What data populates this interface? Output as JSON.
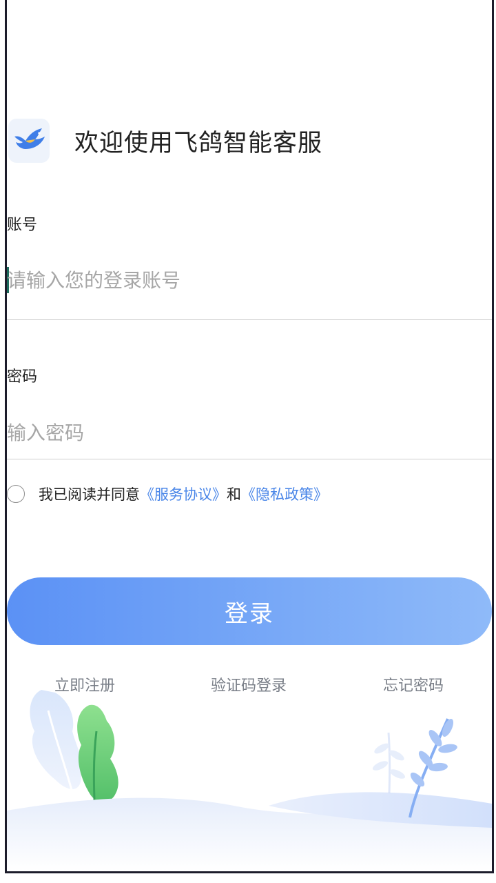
{
  "header": {
    "logo_icon": "pigeon-bird-icon",
    "title": "欢迎使用飞鸽智能客服"
  },
  "account": {
    "label": "账号",
    "placeholder": "请输入您的登录账号",
    "value": ""
  },
  "password": {
    "label": "密码",
    "placeholder": "输入密码",
    "value": ""
  },
  "agreement": {
    "prefix": "我已阅读并同意",
    "service_link": "《服务协议》",
    "conjunction": "和",
    "privacy_link": "《隐私政策》",
    "checked": false
  },
  "login_button": {
    "label": "登录"
  },
  "bottom_links": {
    "register": "立即注册",
    "sms_login": "验证码登录",
    "forgot_password": "忘记密码"
  },
  "colors": {
    "accent": "#5b91f5",
    "link": "#4a86e8",
    "caret": "#1e6b5d"
  }
}
